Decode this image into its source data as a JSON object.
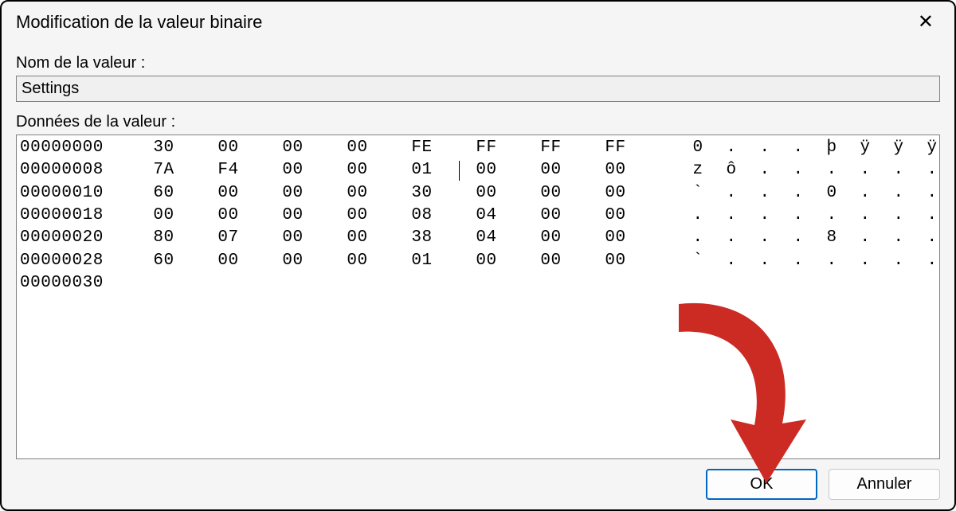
{
  "dialog": {
    "title": "Modification de la valeur binaire",
    "name_label": "Nom de la valeur :",
    "name_value": "Settings",
    "data_label": "Données de la valeur :",
    "rows": [
      {
        "offset": "00000000",
        "bytes": [
          "30",
          "00",
          "00",
          "00",
          "FE",
          "FF",
          "FF",
          "FF"
        ],
        "ascii": [
          "0",
          ".",
          ".",
          ".",
          "þ",
          "ÿ",
          "ÿ",
          "ÿ"
        ]
      },
      {
        "offset": "00000008",
        "bytes": [
          "7A",
          "F4",
          "00",
          "00",
          "01",
          "00",
          "00",
          "00"
        ],
        "ascii": [
          "z",
          "ô",
          ".",
          ".",
          ".",
          ".",
          ".",
          "."
        ]
      },
      {
        "offset": "00000010",
        "bytes": [
          "60",
          "00",
          "00",
          "00",
          "30",
          "00",
          "00",
          "00"
        ],
        "ascii": [
          "`",
          ".",
          ".",
          ".",
          "0",
          ".",
          ".",
          "."
        ]
      },
      {
        "offset": "00000018",
        "bytes": [
          "00",
          "00",
          "00",
          "00",
          "08",
          "04",
          "00",
          "00"
        ],
        "ascii": [
          ".",
          ".",
          ".",
          ".",
          ".",
          ".",
          ".",
          "."
        ]
      },
      {
        "offset": "00000020",
        "bytes": [
          "80",
          "07",
          "00",
          "00",
          "38",
          "04",
          "00",
          "00"
        ],
        "ascii": [
          ".",
          ".",
          ".",
          ".",
          "8",
          ".",
          ".",
          "."
        ]
      },
      {
        "offset": "00000028",
        "bytes": [
          "60",
          "00",
          "00",
          "00",
          "01",
          "00",
          "00",
          "00"
        ],
        "ascii": [
          "`",
          ".",
          ".",
          ".",
          ".",
          ".",
          ".",
          "."
        ]
      },
      {
        "offset": "00000030",
        "bytes": [],
        "ascii": []
      }
    ],
    "cursor_row": 1,
    "cursor_col": 5,
    "buttons": {
      "ok": "OK",
      "cancel": "Annuler"
    }
  },
  "annotation": {
    "arrow_color": "#cc2b24"
  }
}
